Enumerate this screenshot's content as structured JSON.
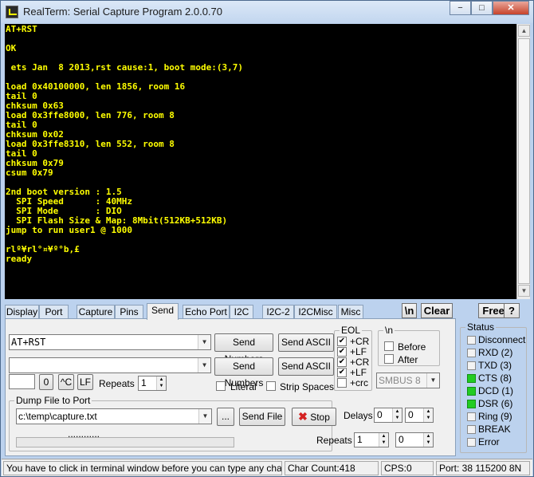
{
  "window": {
    "title": "RealTerm: Serial Capture Program 2.0.0.70",
    "min": "−",
    "max": "□",
    "close": "✕"
  },
  "terminal": {
    "lines": [
      "AT+RST",
      "",
      "OK",
      "",
      " ets Jan  8 2013,rst cause:1, boot mode:(3,7)",
      "",
      "load 0x40100000, len 1856, room 16",
      "tail 0",
      "chksum 0x63",
      "load 0x3ffe8000, len 776, room 8",
      "tail 0",
      "chksum 0x02",
      "load 0x3ffe8310, len 552, room 8",
      "tail 0",
      "chksum 0x79",
      "csum 0x79",
      "",
      "2nd boot version : 1.5",
      "  SPI Speed      : 40MHz",
      "  SPI Mode       : DIO",
      "  SPI Flash Size & Map: 8Mbit(512KB+512KB)",
      "jump to run user1 @ 1000",
      "",
      "rlº¥rl°¤¥º°b,£",
      "ready"
    ]
  },
  "tabs": [
    "Display",
    "Port",
    "Capture",
    "Pins",
    "Send",
    "Echo Port",
    "I2C",
    "I2C-2",
    "I2CMisc",
    "Misc"
  ],
  "toolbar": {
    "newline": "\\n",
    "clear": "Clear",
    "freeze": "Freeze",
    "help": "?"
  },
  "send": {
    "line1_value": "AT+RST",
    "line2_value": "",
    "send_numbers": "Send Numbers",
    "send_ascii": "Send ASCII",
    "repeat_char": "0",
    "cr_btn": "^C",
    "lf_btn": "LF",
    "repeats_label": "Repeats",
    "repeats_value": "1",
    "literal": "Literal",
    "strip_spaces": "Strip Spaces"
  },
  "eol": {
    "title": "EOL",
    "items": [
      {
        "label": "+CR",
        "checked": true
      },
      {
        "label": "+LF",
        "checked": true
      },
      {
        "label": "+CR",
        "checked": true
      },
      {
        "label": "+LF",
        "checked": true
      },
      {
        "label": "+crc",
        "checked": false
      }
    ]
  },
  "nl": {
    "title": "\\n",
    "before": "Before",
    "after": "After"
  },
  "smbus": "SMBUS 8",
  "dump": {
    "title": "Dump File to Port",
    "path": "c:\\temp\\capture.txt",
    "browse": "...",
    "send_file": "Send File",
    "stop": "Stop",
    "delays_label": "Delays",
    "delay1": "0",
    "delay2": "0",
    "repeats_label": "Repeats",
    "repeats1": "1",
    "repeats2": "0",
    "dots": "............"
  },
  "status": {
    "title": "Status",
    "items": [
      {
        "label": "Disconnect",
        "on": false
      },
      {
        "label": "RXD (2)",
        "on": false
      },
      {
        "label": "TXD (3)",
        "on": false
      },
      {
        "label": "CTS (8)",
        "on": true
      },
      {
        "label": "DCD (1)",
        "on": true
      },
      {
        "label": "DSR (6)",
        "on": true
      },
      {
        "label": "Ring (9)",
        "on": false
      },
      {
        "label": "BREAK",
        "on": false
      },
      {
        "label": "Error",
        "on": false
      }
    ]
  },
  "statusbar": {
    "hint": "You have to click in terminal window before you can type any cha",
    "char_count": "Char Count:418",
    "cps": "CPS:0",
    "port": "Port: 38 115200 8N"
  },
  "colors": {
    "terminal_bg": "#000000",
    "terminal_fg": "#ffff00",
    "led_on": "#22cc22"
  }
}
